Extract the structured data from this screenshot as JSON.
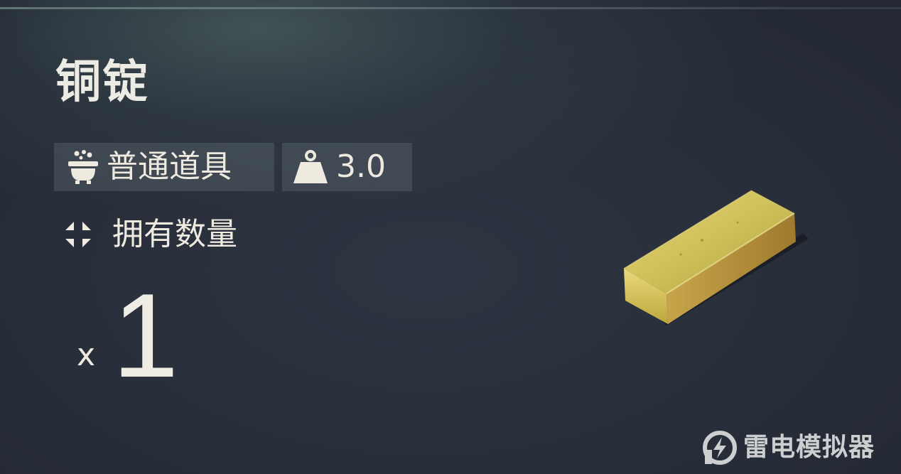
{
  "item": {
    "name": "铜锭",
    "rarity_icon": "cauldron-icon",
    "rarity": "普通道具",
    "weight_icon": "weight-icon",
    "weight": "3.0",
    "owned_icon": "crosshair-icon",
    "owned_label": "拥有数量",
    "quantity_prefix": "x",
    "quantity": "1",
    "image": "ingot-image"
  },
  "watermark": {
    "icon": "lightning-logo-icon",
    "text": "雷电模拟器"
  },
  "colors": {
    "background": "#272d38",
    "text": "#eeeae0",
    "tag_background": "#4a515c",
    "ingot": "#c9b74a"
  }
}
